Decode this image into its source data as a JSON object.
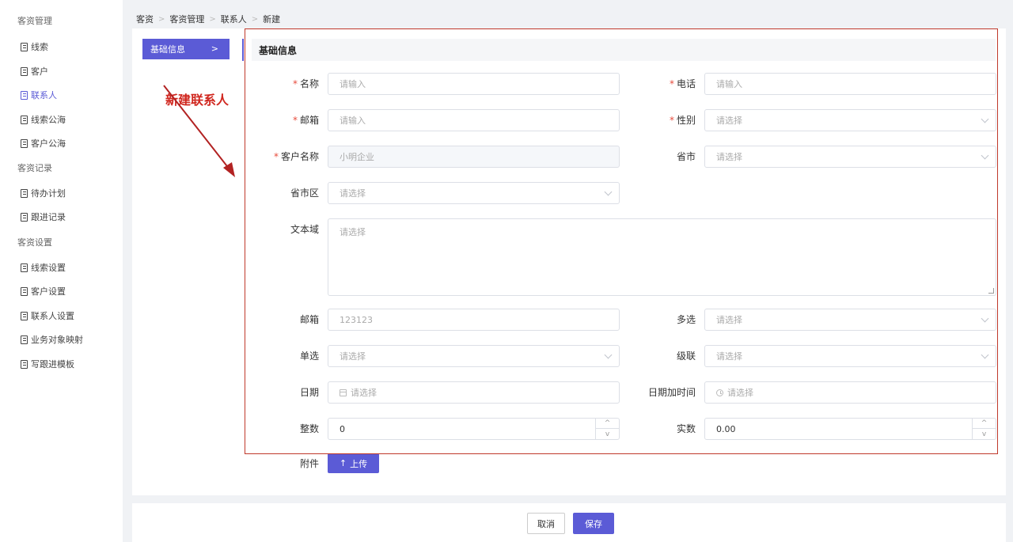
{
  "sidebar": {
    "groups": [
      {
        "title": "客资管理",
        "items": [
          "线索",
          "客户",
          "联系人",
          "线索公海",
          "客户公海"
        ]
      },
      {
        "title": "客资记录",
        "items": [
          "待办计划",
          "跟进记录"
        ]
      },
      {
        "title": "客资设置",
        "items": [
          "线索设置",
          "客户设置",
          "联系人设置",
          "业务对象映射",
          "写跟进模板"
        ]
      }
    ]
  },
  "breadcrumb": [
    "客资",
    "客资管理",
    "联系人",
    "新建"
  ],
  "step_tab": "基础信息",
  "section_title": "基础信息",
  "annotation": "新建联系人",
  "form": {
    "name": {
      "label": "名称",
      "placeholder": "请输入"
    },
    "phone": {
      "label": "电话",
      "placeholder": "请输入"
    },
    "email": {
      "label": "邮箱",
      "placeholder": "请输入"
    },
    "gender": {
      "label": "性别",
      "placeholder": "请选择"
    },
    "customer_name": {
      "label": "客户名称",
      "value": "小明企业"
    },
    "province_city": {
      "label": "省市",
      "placeholder": "请选择"
    },
    "province_city_district": {
      "label": "省市区",
      "placeholder": "请选择"
    },
    "textarea": {
      "label": "文本域",
      "placeholder": "请选择"
    },
    "email2": {
      "label": "邮箱",
      "value": "123123"
    },
    "multi_select": {
      "label": "多选",
      "placeholder": "请选择"
    },
    "single_select": {
      "label": "单选",
      "placeholder": "请选择"
    },
    "cascade": {
      "label": "级联",
      "placeholder": "请选择"
    },
    "date": {
      "label": "日期",
      "placeholder": "请选择"
    },
    "datetime": {
      "label": "日期加时间",
      "placeholder": "请选择"
    },
    "integer": {
      "label": "整数",
      "value": "0"
    },
    "real": {
      "label": "实数",
      "value": "0.00"
    },
    "attachment": {
      "label": "附件",
      "button": "上传"
    }
  },
  "footer": {
    "cancel": "取消",
    "save": "保存"
  },
  "colors": {
    "accent": "#5b5bd6",
    "annotation": "#d0271f",
    "required": "#e74c3c"
  }
}
